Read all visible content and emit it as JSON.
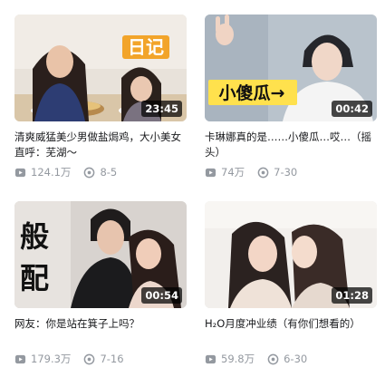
{
  "videos": [
    {
      "title": "清爽威猛美少男做盐焗鸡，大小美女直呼：芜湖～",
      "duration": "23:45",
      "plays": "124.1万",
      "comments": "8-5",
      "overlay_text": "日记"
    },
    {
      "title": "卡琳娜真的是……小傻瓜…哎…（摇头）",
      "duration": "00:42",
      "plays": "74万",
      "comments": "7-30",
      "overlay_text": "小傻瓜→"
    },
    {
      "title": "网友：你是站在箕子上吗？",
      "duration": "00:54",
      "plays": "179.3万",
      "comments": "7-16",
      "overlay_text": "般配"
    },
    {
      "title": "H₂O月度冲业绩（有你们想看的）",
      "duration": "01:28",
      "plays": "59.8万",
      "comments": "6-30",
      "overlay_text": ""
    }
  ],
  "icons": {
    "plays": "play-count-icon",
    "comments": "danmaku-count-icon"
  }
}
